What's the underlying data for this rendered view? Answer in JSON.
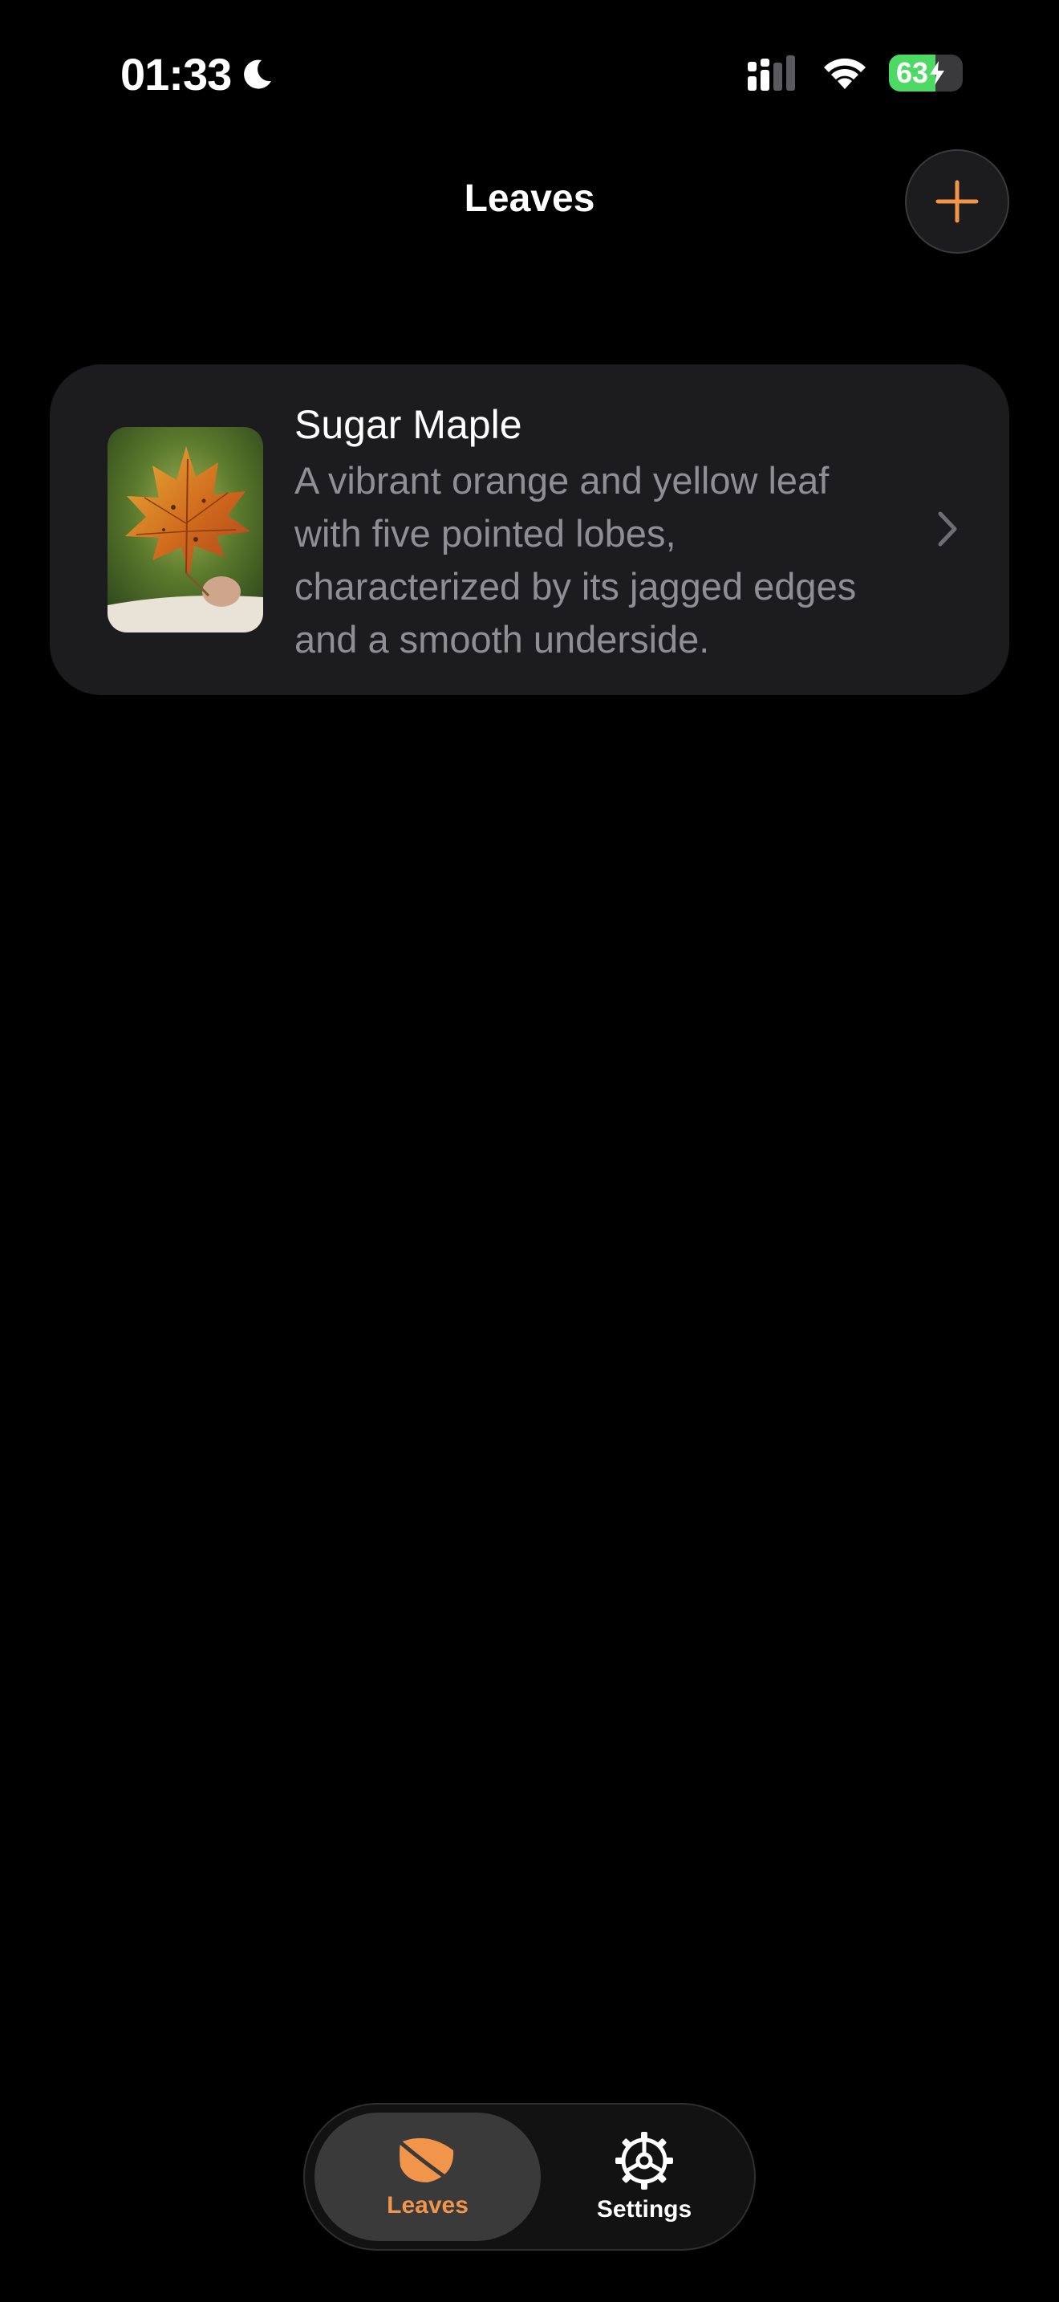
{
  "status_bar": {
    "time": "01:33",
    "battery_level": "63",
    "battery_fraction": 0.63
  },
  "colors": {
    "accent": "#f0954a",
    "card_background": "#1c1c1e",
    "secondary_text": "#8e8e93",
    "battery_green": "#4cd964"
  },
  "icons": {
    "moon": "moon-icon",
    "signal": "signal-icon",
    "wifi": "wifi-icon",
    "battery": "battery-charging-icon",
    "add": "plus-icon",
    "chevron": "chevron-right-icon",
    "leaf": "leaf-icon",
    "settings": "gear-icon"
  },
  "header": {
    "title": "Leaves"
  },
  "leaves": [
    {
      "name": "Sugar Maple",
      "description": "A vibrant orange and yellow leaf with five pointed lobes, characterized by its jagged edges and a smooth underside."
    }
  ],
  "tab_bar": {
    "tabs": [
      {
        "label": "Leaves",
        "selected": true
      },
      {
        "label": "Settings",
        "selected": false
      }
    ]
  }
}
